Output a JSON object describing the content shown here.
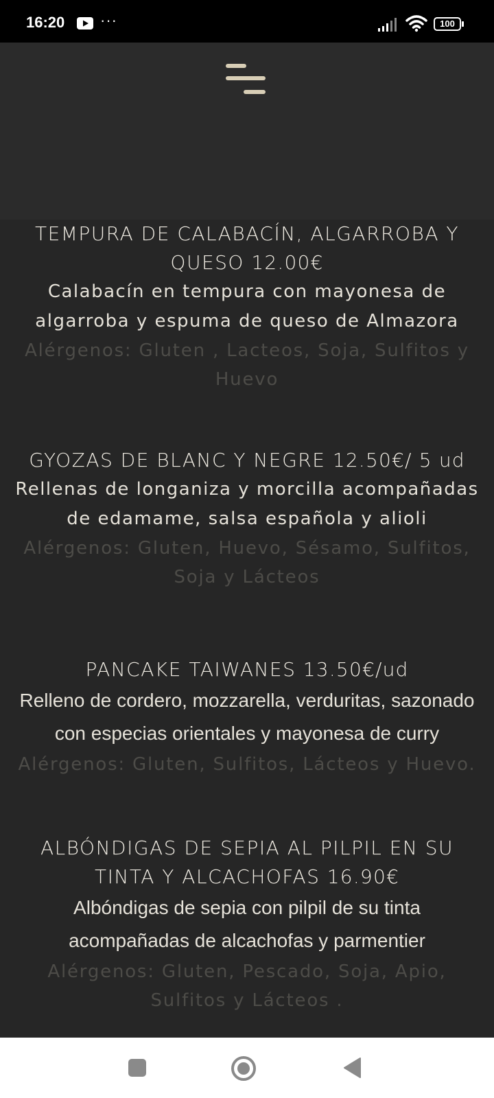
{
  "status_bar": {
    "time": "16:20",
    "more": "···",
    "battery": "100",
    "icons": [
      "youtube-icon",
      "signal-icon",
      "wifi-icon",
      "battery-icon"
    ]
  },
  "header": {
    "menu_icon": "hamburger-menu-icon"
  },
  "colors": {
    "background": "#262626",
    "header_background": "#2b2b2b",
    "title_text": "#efebe2",
    "allergen_text": "#4d4c48",
    "accent": "#d8ceb6"
  },
  "menu_items": [
    {
      "title": "TEMPURA DE CALABACÍN, ALGARROBA Y QUESO",
      "price": "12.00€",
      "description": "Calabacín en tempura con mayonesa de algarroba y espuma de queso de Almazora",
      "allergens": "Alérgenos: Gluten , Lacteos, Soja, Sulfitos y Huevo"
    },
    {
      "title": "GYOZAS DE BLANC Y NEGRE",
      "price": "12.50€/ 5 ud",
      "description": "Rellenas de longaniza y morcilla acompañadas de edamame, salsa española y alioli",
      "allergens": "Alérgenos: Gluten, Huevo, Sésamo, Sulfitos, Soja y Lácteos"
    },
    {
      "title": "PANCAKE TAIWANES",
      "price": "13.50€/ud",
      "description": "Relleno de cordero, mozzarella, verduritas, sazonado con especias orientales y mayonesa de curry",
      "allergens": "Alérgenos: Gluten, Sulfitos, Lácteos y Huevo."
    },
    {
      "title": "ALBÓNDIGAS DE SEPIA AL PILPIL EN SU TINTA Y ALCACHOFAS",
      "price": "16.90€",
      "description": "Albóndigas de sepia con pilpil de su tinta acompañadas de alcachofas y parmentier",
      "allergens": "Alérgenos: Gluten, Pescado, Soja, Apio, Sulfitos y Lácteos ."
    }
  ],
  "nav_bar": {
    "icons": [
      "recent-apps-icon",
      "home-icon",
      "back-icon"
    ]
  }
}
